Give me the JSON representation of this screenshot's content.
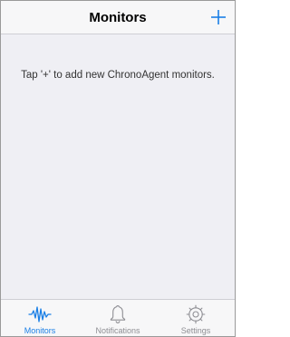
{
  "navbar": {
    "title": "Monitors",
    "add_icon": "plus-icon"
  },
  "content": {
    "empty_message": "Tap '+' to add new ChronoAgent monitors."
  },
  "tabbar": {
    "tabs": [
      {
        "label": "Monitors",
        "icon": "waveform-icon",
        "active": true
      },
      {
        "label": "Notifications",
        "icon": "bell-icon",
        "active": false
      },
      {
        "label": "Settings",
        "icon": "gear-icon",
        "active": false
      }
    ]
  },
  "colors": {
    "accent": "#1a7fe6",
    "inactive": "#8e8e93",
    "background": "#efeff4"
  }
}
